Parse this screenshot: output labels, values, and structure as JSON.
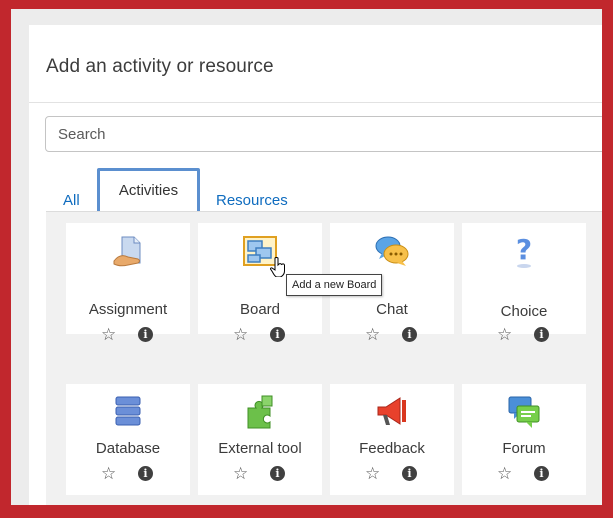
{
  "modal": {
    "title": "Add an activity or resource"
  },
  "search": {
    "placeholder": "Search"
  },
  "tabs": [
    {
      "label": "All",
      "active": false
    },
    {
      "label": "Activities",
      "active": true
    },
    {
      "label": "Resources",
      "active": false
    }
  ],
  "tiles": [
    {
      "label": "Assignment",
      "icon": "assignment-icon"
    },
    {
      "label": "Board",
      "icon": "board-icon"
    },
    {
      "label": "Chat",
      "icon": "chat-icon"
    },
    {
      "label": "Choice",
      "icon": "choice-icon"
    },
    {
      "label": "Database",
      "icon": "database-icon"
    },
    {
      "label": "External tool",
      "icon": "external-tool-icon"
    },
    {
      "label": "Feedback",
      "icon": "feedback-icon"
    },
    {
      "label": "Forum",
      "icon": "forum-icon"
    }
  ],
  "tooltip": {
    "text": "Add a new Board"
  },
  "colors": {
    "border": "#c1272d",
    "link": "#0f6cbf",
    "tab_highlight": "#5b8fcf"
  }
}
